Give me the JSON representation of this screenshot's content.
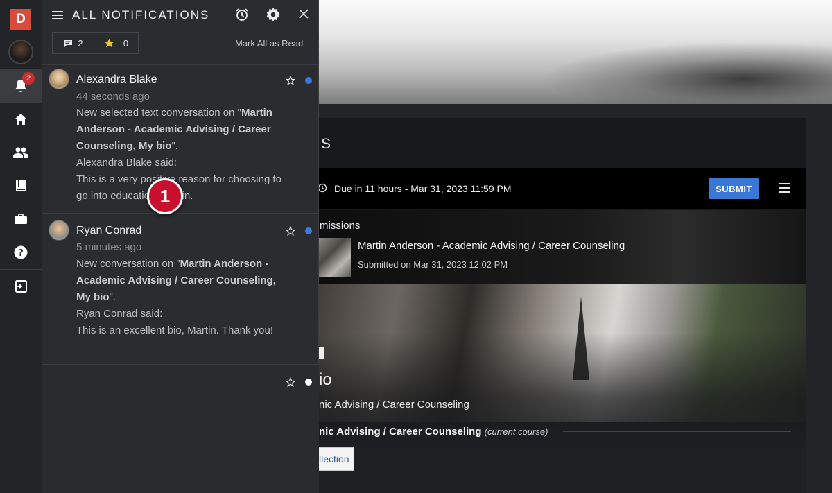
{
  "rail": {
    "logo_letter": "D",
    "bell_badge_count": "2",
    "items": [
      {
        "name": "home-icon"
      },
      {
        "name": "people-icon"
      },
      {
        "name": "book-icon"
      },
      {
        "name": "briefcase-icon"
      },
      {
        "name": "help-icon"
      },
      {
        "name": "logout-icon"
      }
    ]
  },
  "panel": {
    "title": "ALL NOTIFICATIONS",
    "comment_count": "2",
    "star_count": "0",
    "mark_all_label": "Mark All as Read"
  },
  "notifications": [
    {
      "name": "Alexandra Blake",
      "time": "44 seconds ago",
      "line1_prefix": "New selected text conversation on \"",
      "course_bold": "Martin Anderson - Academic Advising / Career Counseling, My bio",
      "line1_suffix": "\".",
      "said": "Alexandra Blake said:",
      "message": "This is a very positive reason for choosing to go into education, Martin.",
      "unread_color": "#3b7be0"
    },
    {
      "name": "Ryan Conrad",
      "time": "5 minutes ago",
      "line1_prefix": "New conversation on \"",
      "course_bold": "Martin Anderson - Academic Advising / Career Counseling, My bio",
      "line1_suffix": "\".",
      "said": "Ryan Conrad said:",
      "message": "This is an excellent bio, Martin. Thank you!",
      "unread_color": "#3b7be0"
    }
  ],
  "empty_row": {
    "dot_color": "#ffffff"
  },
  "step_marker": "1",
  "page": {
    "title_fragment": "S",
    "due_text": "Due in 11 hours - Mar 31, 2023 11:59 PM",
    "submit_label": "SUBMIT",
    "submissions_heading": "missions",
    "submission_title": "Martin Anderson - Academic Advising / Career Counseling",
    "submission_date": "Submitted on Mar 31, 2023 12:02 PM",
    "bio_title_fragment": "io",
    "bio_course_fragment": "nic Advising / Career Counseling",
    "course_fragment": "nic Advising / Career Counseling",
    "current_course_label": "(current course)",
    "collection_button_fragment": "llection"
  },
  "colors": {
    "accent": "#3a78d8",
    "logo": "#d94b3a",
    "badge": "#c53030",
    "marker": "#c8102e"
  }
}
